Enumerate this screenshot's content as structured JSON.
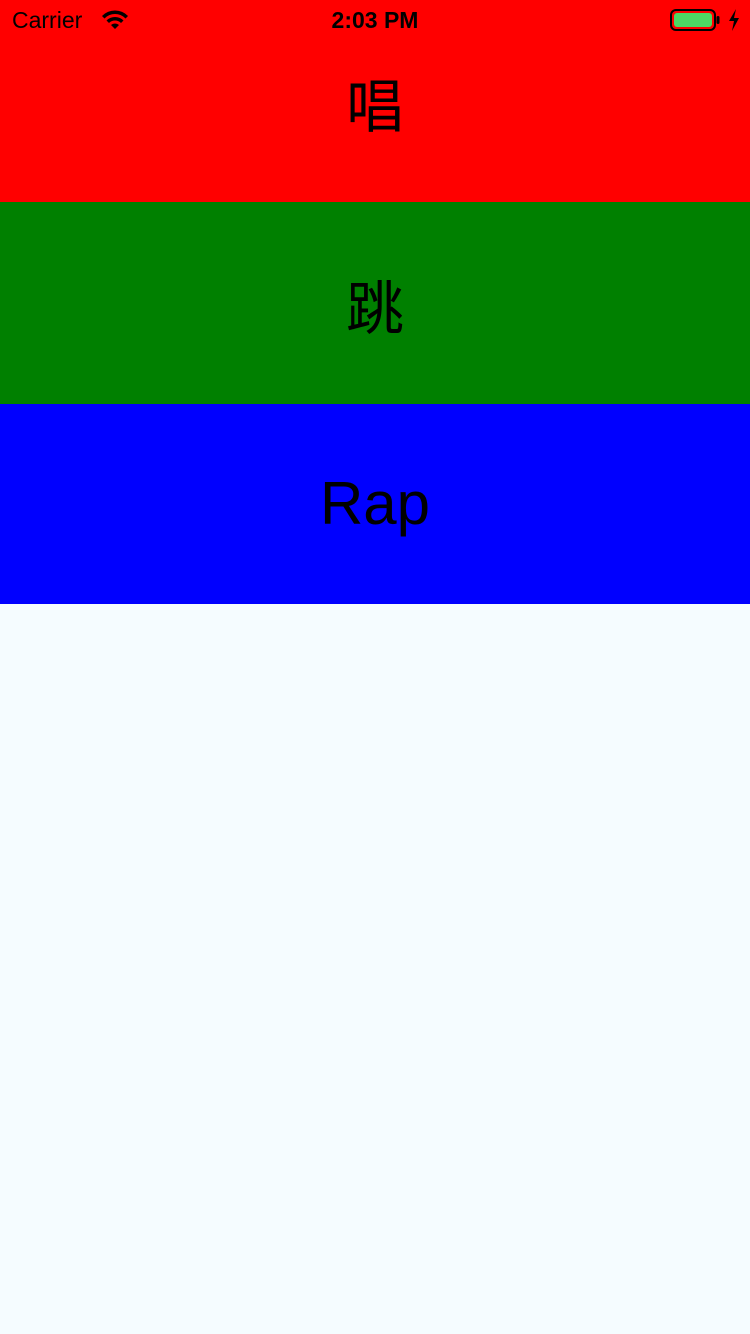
{
  "status_bar": {
    "carrier": "Carrier",
    "time": "2:03 PM",
    "wifi_icon": "wifi-icon",
    "battery_icon": "battery-icon",
    "charging_icon": "charging-bolt-icon",
    "battery_color": "#4cd964"
  },
  "rows": [
    {
      "label": "唱",
      "color": "#ff0000"
    },
    {
      "label": "跳",
      "color": "#008000"
    },
    {
      "label": "Rap",
      "color": "#0000ff"
    }
  ],
  "background_color": "#f5fcff"
}
